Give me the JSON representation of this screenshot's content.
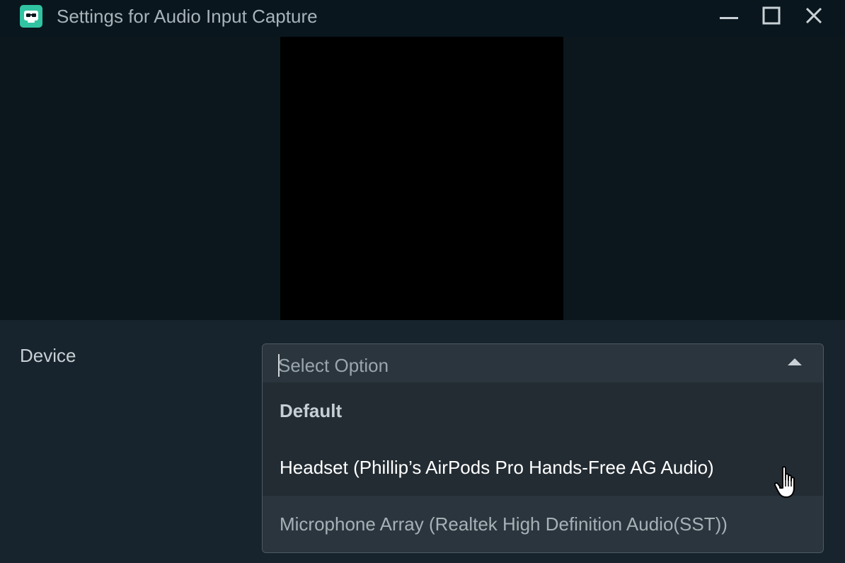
{
  "window": {
    "title": "Settings for Audio Input Capture",
    "icon": "streamlabs-logo-icon",
    "controls": [
      "minimize-icon",
      "maximize-icon",
      "close-icon"
    ]
  },
  "form": {
    "device_label": "Device",
    "device_select": {
      "placeholder": "Select Option",
      "expanded": true,
      "options": [
        {
          "label": "Default"
        },
        {
          "label": "Headset (Phillip’s AirPods Pro Hands-Free AG Audio)"
        },
        {
          "label": "Microphone Array (Realtek High Definition Audio(SST))"
        }
      ]
    }
  },
  "colors": {
    "titlebar": "#09161d",
    "background": "#17242d",
    "preview": "#000000",
    "accent": "#31c3a2"
  }
}
